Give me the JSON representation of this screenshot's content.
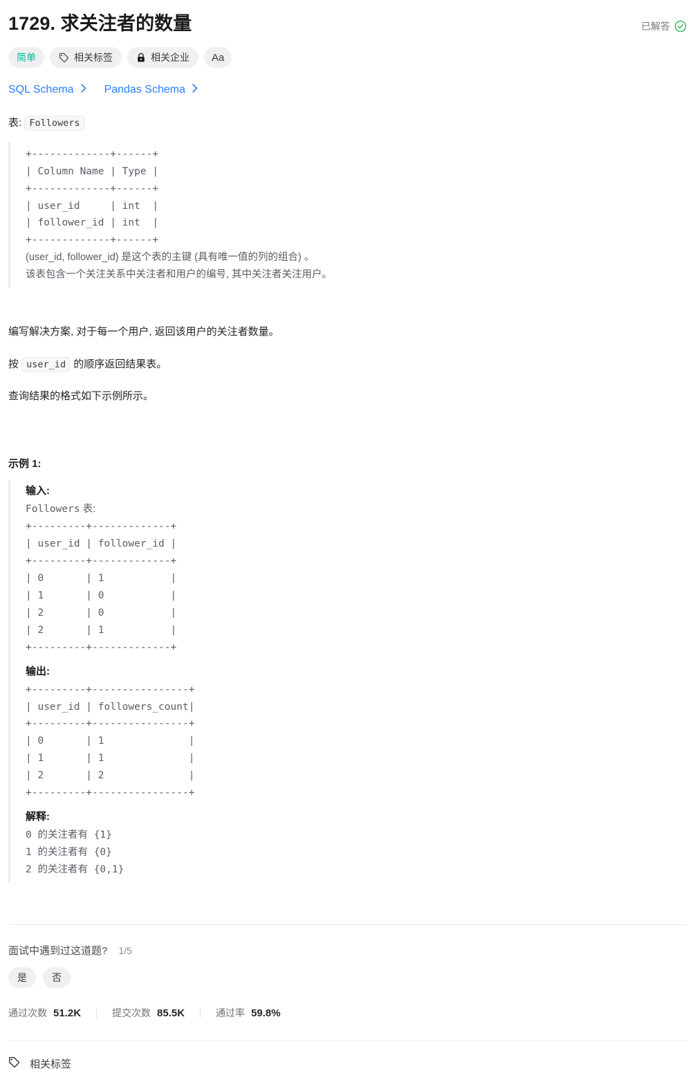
{
  "header": {
    "title": "1729. 求关注者的数量",
    "status_label": "已解答",
    "status_icon": "check-circle-icon",
    "status_color": "#2db55d"
  },
  "pills": [
    {
      "label": "简单",
      "icon": null,
      "name": "difficulty-badge",
      "color": "#00b8a3"
    },
    {
      "label": "相关标签",
      "icon": "tag-icon",
      "name": "related-tags-button"
    },
    {
      "label": "相关企业",
      "icon": "lock-icon",
      "name": "related-companies-button"
    },
    {
      "label": "Aa",
      "icon": null,
      "name": "font-size-button"
    }
  ],
  "schema_links": [
    {
      "label": "SQL Schema",
      "icon": "chevron-right-icon",
      "name": "sql-schema-link"
    },
    {
      "label": "Pandas Schema",
      "icon": "chevron-right-icon",
      "name": "pandas-schema-link"
    }
  ],
  "content": {
    "table_intro_label": "表:",
    "table_name": "Followers",
    "schema_block": "+-------------+------+\n| Column Name | Type |\n+-------------+------+\n| user_id     | int  |\n| follower_id | int  |\n+-------------+------+",
    "schema_note_1": "(user_id, follower_id) 是这个表的主键 (具有唯一值的列的组合) 。",
    "schema_note_2": "该表包含一个关注关系中关注者和用户的编号, 其中关注者关注用户。",
    "para_1": "编写解决方案, 对于每一个用户, 返回该用户的关注者数量。",
    "para_2_prefix": "按 ",
    "para_2_code": "user_id",
    "para_2_suffix": " 的顺序返回结果表。",
    "para_3": "查询结果的格式如下示例所示。"
  },
  "example": {
    "title": "示例 1:",
    "input_label": "输入:",
    "input_table_caption_code": "Followers",
    "input_table_caption_zh": " 表:",
    "input_table": "+---------+-------------+\n| user_id | follower_id |\n+---------+-------------+\n| 0       | 1           |\n| 1       | 0           |\n| 2       | 0           |\n| 2       | 1           |\n+---------+-------------+",
    "output_label": "输出:",
    "output_table": "+---------+----------------+\n| user_id | followers_count|\n+---------+----------------+\n| 0       | 1              |\n| 1       | 1              |\n| 2       | 2              |\n+---------+----------------+",
    "explanation_label": "解释:",
    "explanation_lines": [
      "0 的关注者有 {1}",
      "1 的关注者有 {0}",
      "2 的关注者有 {0,1}"
    ]
  },
  "example_data": {
    "input_columns": [
      "user_id",
      "follower_id"
    ],
    "input_rows": [
      [
        0,
        1
      ],
      [
        1,
        0
      ],
      [
        2,
        0
      ],
      [
        2,
        1
      ]
    ],
    "output_columns": [
      "user_id",
      "followers_count"
    ],
    "output_rows": [
      [
        0,
        1
      ],
      [
        1,
        1
      ],
      [
        2,
        2
      ]
    ]
  },
  "schema_table": {
    "columns": [
      "Column Name",
      "Type"
    ],
    "rows": [
      [
        "user_id",
        "int"
      ],
      [
        "follower_id",
        "int"
      ]
    ]
  },
  "footer": {
    "interview_question": "面试中遇到过这道题?",
    "interview_count": "1/5",
    "yes_label": "是",
    "no_label": "否",
    "stats": [
      {
        "label": "通过次数",
        "value": "51.2K",
        "name": "accepted-count"
      },
      {
        "label": "提交次数",
        "value": "85.5K",
        "name": "submission-count"
      },
      {
        "label": "通过率",
        "value": "59.8%",
        "name": "acceptance-rate"
      }
    ],
    "tags_label": "相关标签",
    "tags_icon": "tag-icon"
  }
}
